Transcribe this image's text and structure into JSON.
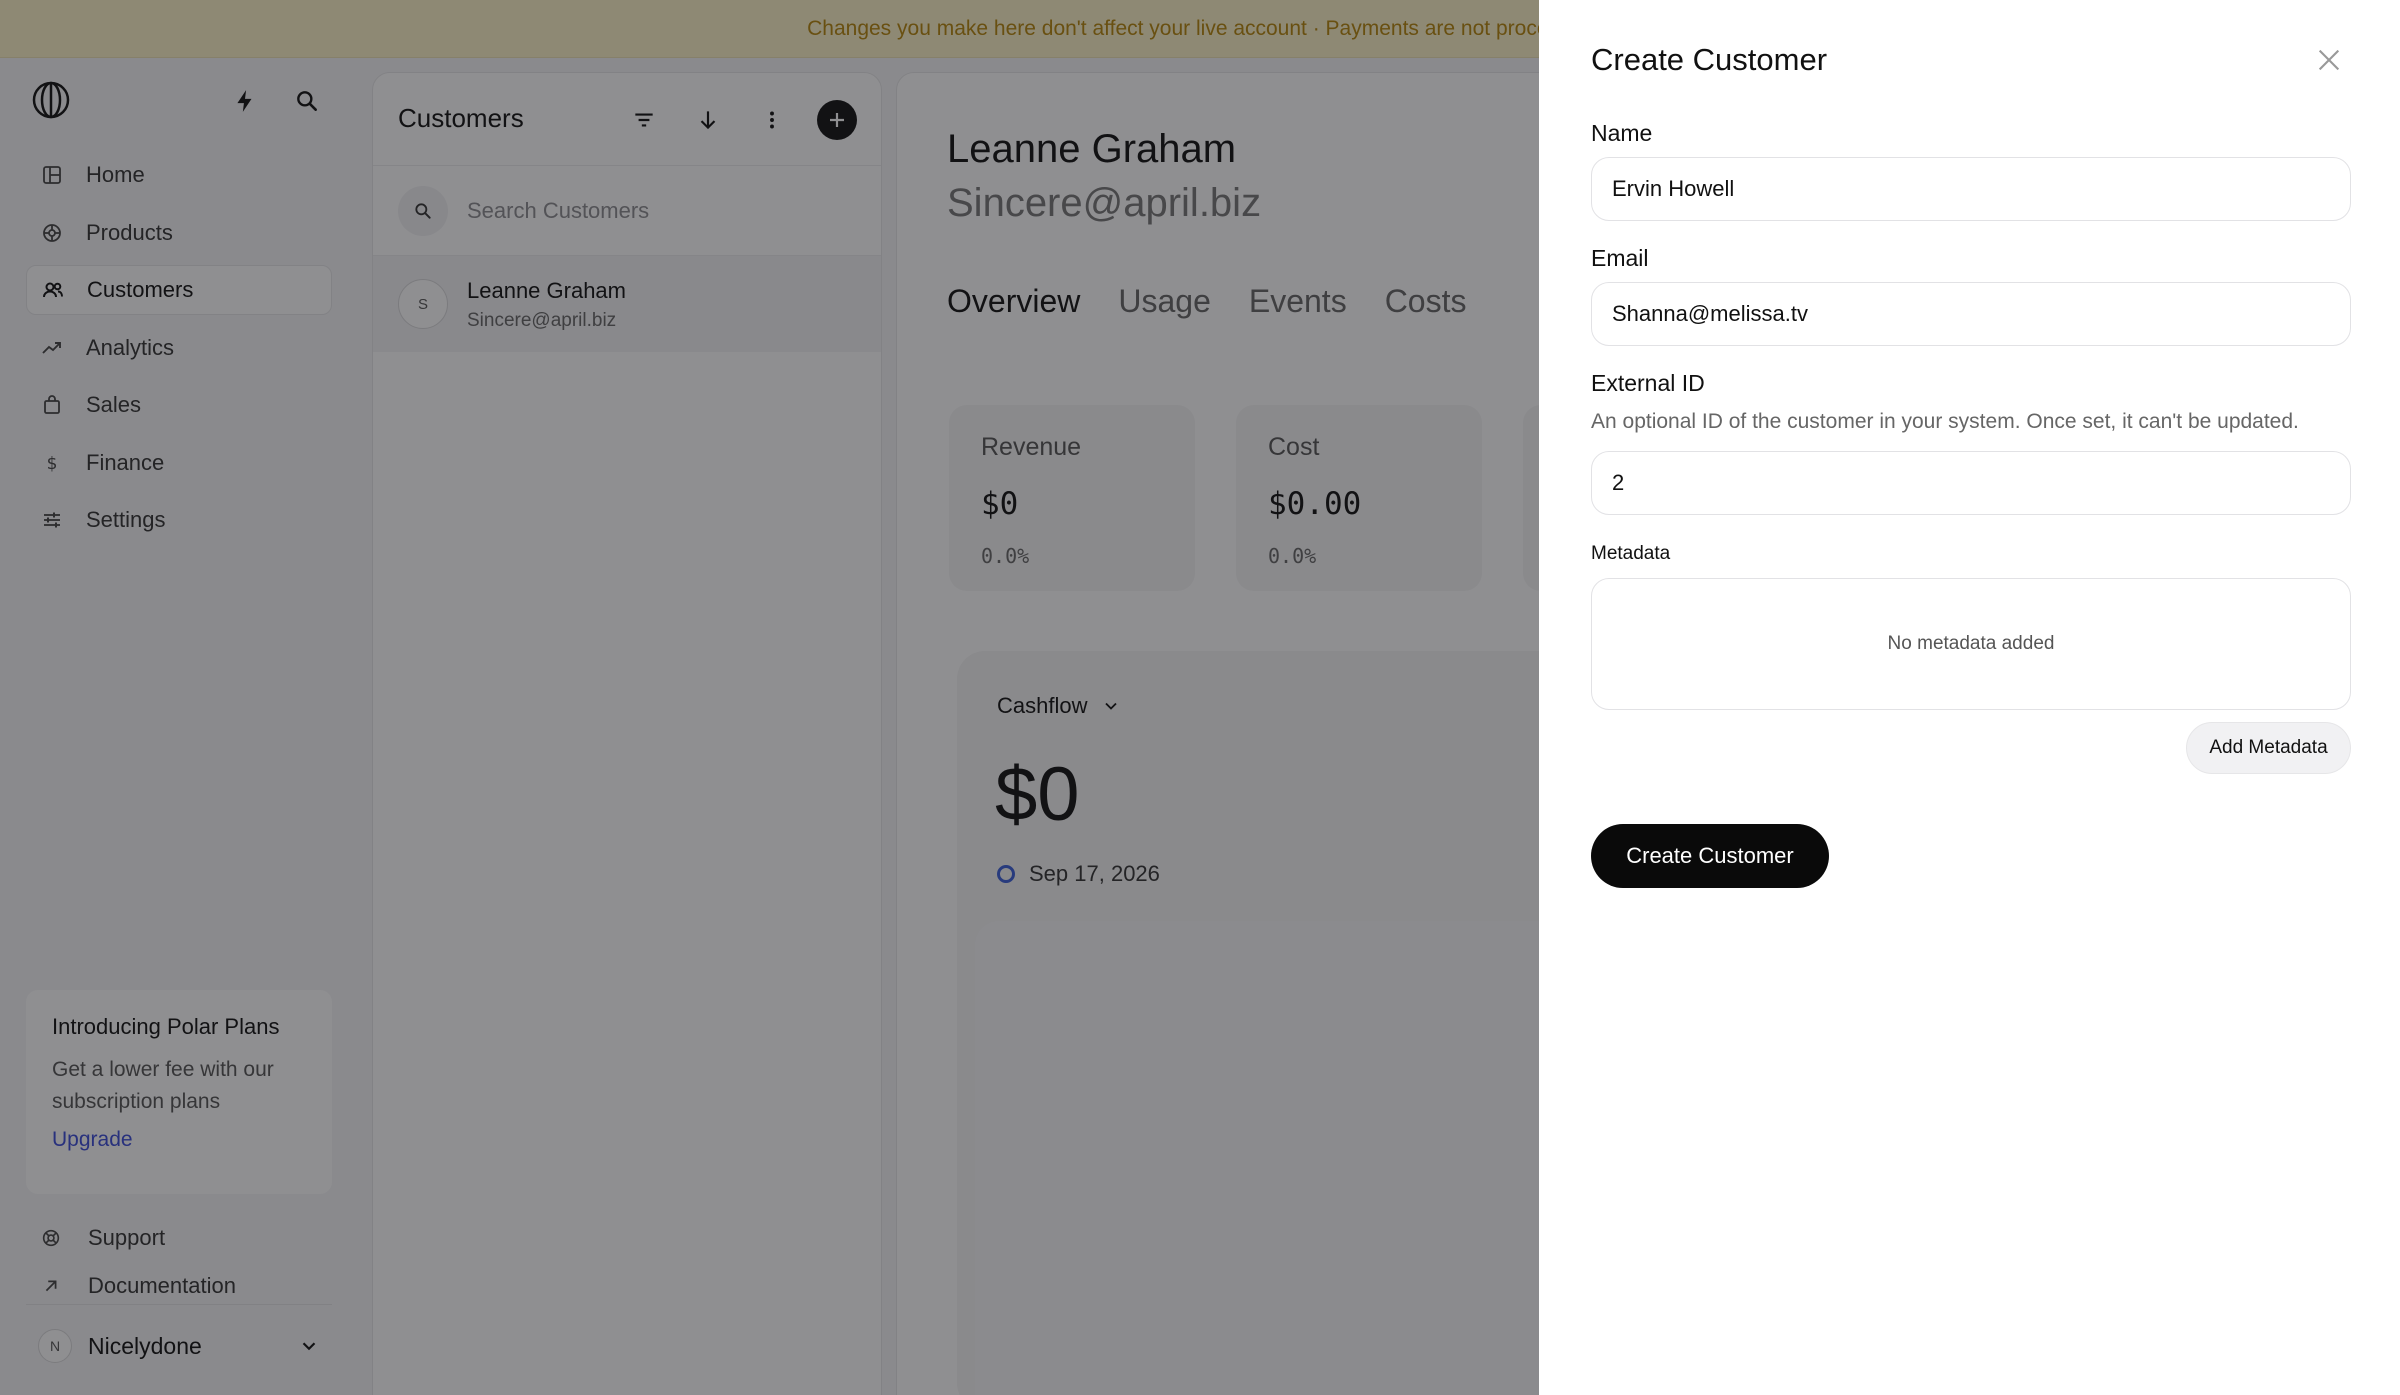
{
  "banner": {
    "text": "Changes you make here don't affect your live account · Payments are not processed"
  },
  "sidebar": {
    "items": [
      {
        "label": "Home",
        "icon": "home-icon"
      },
      {
        "label": "Products",
        "icon": "products-icon"
      },
      {
        "label": "Customers",
        "icon": "customers-icon",
        "active": true
      },
      {
        "label": "Analytics",
        "icon": "analytics-icon"
      },
      {
        "label": "Sales",
        "icon": "sales-icon"
      },
      {
        "label": "Finance",
        "icon": "finance-icon"
      },
      {
        "label": "Settings",
        "icon": "settings-icon"
      }
    ],
    "promo": {
      "title": "Introducing Polar Plans",
      "text": "Get a lower fee with our subscription plans",
      "link": "Upgrade"
    },
    "support": "Support",
    "documentation": "Documentation",
    "account": {
      "initial": "N",
      "name": "Nicelydone"
    }
  },
  "customers_panel": {
    "title": "Customers",
    "search_placeholder": "Search Customers",
    "rows": [
      {
        "initial": "S",
        "name": "Leanne Graham",
        "email": "Sincere@april.biz"
      }
    ]
  },
  "detail": {
    "name": "Leanne Graham",
    "email": "Sincere@april.biz",
    "tabs": [
      "Overview",
      "Usage",
      "Events",
      "Costs"
    ],
    "stats": [
      {
        "label": "Revenue",
        "value": "$0",
        "pct": "0.0%"
      },
      {
        "label": "Cost",
        "value": "$0.00",
        "pct": "0.0%"
      }
    ],
    "cashflow": {
      "selector": "Cashflow",
      "value": "$0",
      "date": "Sep 17, 2026"
    }
  },
  "drawer": {
    "title": "Create Customer",
    "name_label": "Name",
    "name_value": "Ervin Howell",
    "email_label": "Email",
    "email_value": "Shanna@melissa.tv",
    "external_id_label": "External ID",
    "external_id_desc": "An optional ID of the customer in your system. Once set, it can't be updated.",
    "external_id_value": "2",
    "metadata_label": "Metadata",
    "metadata_empty": "No metadata added",
    "add_metadata": "Add Metadata",
    "submit": "Create Customer"
  },
  "colors": {
    "banner_bg": "#fdf3c8",
    "banner_text": "#b7860b",
    "link": "#3b4bd8",
    "primary_button": "#0a0a0a",
    "date_marker": "#3b5fd8"
  }
}
